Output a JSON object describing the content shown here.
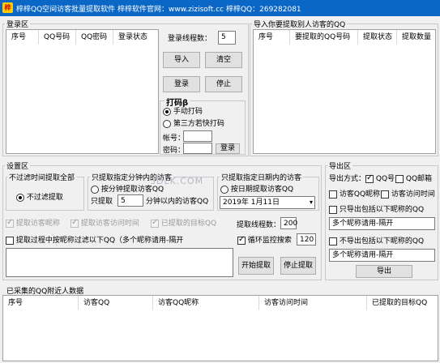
{
  "titlebar": {
    "title": "梓梓QQ空间访客批量提取软件  梓梓软件官网：www.zizisoft.cc  梓梓QQ：269282081"
  },
  "login": {
    "group_label": "登录区",
    "columns": [
      "序号",
      "QQ号码",
      "QQ密码",
      "登录状态"
    ],
    "threads_label": "登录线程数：",
    "threads_value": "5",
    "import_label": "导入",
    "clear_label": "清空",
    "login_label": "登录",
    "stop_label": "停止",
    "captcha": {
      "group_label": "打码β",
      "manual_label": "手动打码",
      "third_party_label": "第三方若快打码",
      "account_label": "帐号：",
      "password_label": "密码：",
      "login_label": "登录"
    }
  },
  "import_target": {
    "group_label": "导入你要提取别人访客的QQ",
    "columns": [
      "序号",
      "要提取的QQ号码",
      "提取状态",
      "提取数量"
    ]
  },
  "settings": {
    "group_label": "设置区",
    "no_time": {
      "group_label": "不过滤时间提取全部",
      "radio_label": "不过滤提取"
    },
    "by_minutes": {
      "group_label": "只提取指定分钟内的访客",
      "radio_label": "按分钟提取访客QQ",
      "prefix": "只提取",
      "value": "5",
      "suffix": "分钟以内的访客QQ"
    },
    "by_date": {
      "group_label": "只提取指定日期内的访客",
      "radio_label": "按日期提取访客QQ",
      "date_value": "2019年 1月11日"
    },
    "watermark": "3DLK.COM",
    "chk_nick": "提取访客昵称",
    "chk_time": "提取访客访问时间",
    "chk_target": "已提取的目标QQ",
    "extract_threads_label": "提取线程数：",
    "extract_threads_value": "200",
    "filter_label": "提取过程中按昵称过滤以下QQ（多个昵称请用-隔开",
    "loop_label": "循环监控搜索",
    "loop_value": "120",
    "start_label": "开始提取",
    "stop_label": "停止提取"
  },
  "export": {
    "group_label": "导出区",
    "method_label": "导出方式：",
    "qq_label": "QQ号",
    "email_label": "QQ邮箱",
    "nick_label": "访客QQ昵称",
    "time_label": "访客访问时间",
    "only_include_label": "只导出包括以下昵称的QQ",
    "include_value": "多个昵称请用-隔开",
    "exclude_label": "不导出包括以下昵称的QQ",
    "exclude_value": "多个昵称请用-隔开",
    "export_label": "导出"
  },
  "results": {
    "group_label": "已采集的QQ附近人数据",
    "columns": [
      "序号",
      "访客QQ",
      "访客QQ昵称",
      "访客访问时间",
      "已提取的目标QQ"
    ]
  }
}
